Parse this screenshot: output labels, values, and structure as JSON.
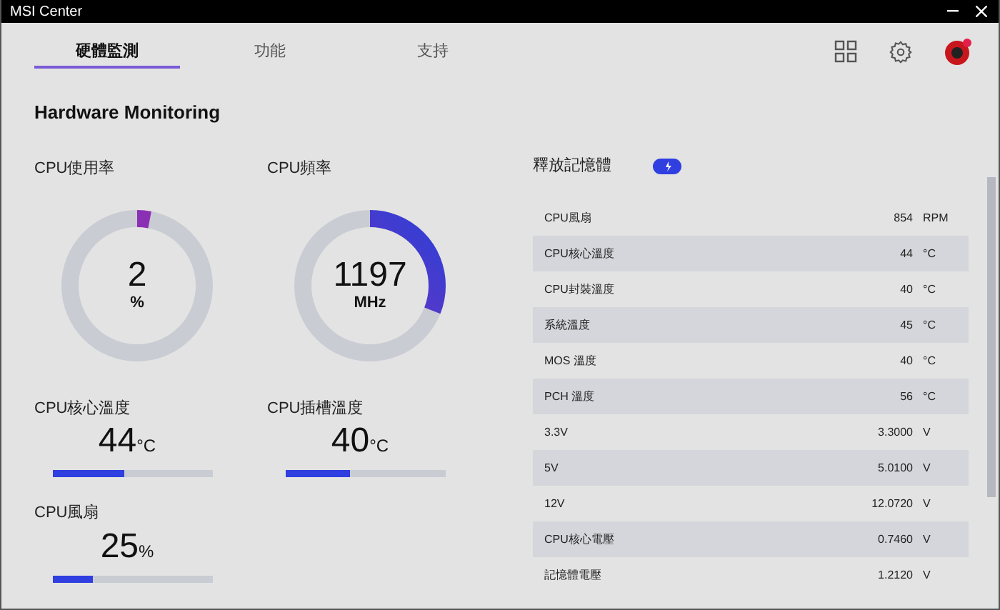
{
  "window": {
    "title": "MSI Center"
  },
  "tabs": [
    {
      "label": "硬體監測",
      "selected": true
    },
    {
      "label": "功能",
      "selected": false
    },
    {
      "label": "支持",
      "selected": false
    }
  ],
  "heading": "Hardware Monitoring",
  "gauges": [
    {
      "label": "CPU使用率",
      "value": "2",
      "unit": "%",
      "level": 0.03
    },
    {
      "label": "CPU頻率",
      "value": "1197",
      "unit": "MHz",
      "level": 0.31
    }
  ],
  "meters": [
    {
      "label": "CPU核心溫度",
      "value": "44",
      "unit": "°C",
      "level": 0.45
    },
    {
      "label": "CPU插槽溫度",
      "value": "40",
      "unit": "°C",
      "level": 0.4
    },
    {
      "label": "CPU風扇",
      "value": "25",
      "unit": "%",
      "level": 0.25
    }
  ],
  "memory": {
    "label": "釋放記憶體",
    "on": true
  },
  "sensors": [
    {
      "name": "CPU風扇",
      "value": "854",
      "unit": "RPM"
    },
    {
      "name": "CPU核心溫度",
      "value": "44",
      "unit": "°C"
    },
    {
      "name": "CPU封裝溫度",
      "value": "40",
      "unit": "°C"
    },
    {
      "name": "系統溫度",
      "value": "45",
      "unit": "°C"
    },
    {
      "name": "MOS 溫度",
      "value": "40",
      "unit": "°C"
    },
    {
      "name": "PCH 溫度",
      "value": "56",
      "unit": "°C"
    },
    {
      "name": "3.3V",
      "value": "3.3000",
      "unit": "V"
    },
    {
      "name": "5V",
      "value": "5.0100",
      "unit": "V"
    },
    {
      "name": "12V",
      "value": "12.0720",
      "unit": "V"
    },
    {
      "name": "CPU核心電壓",
      "value": "0.7460",
      "unit": "V"
    },
    {
      "name": "記憶體電壓",
      "value": "1.2120",
      "unit": "V"
    }
  ]
}
